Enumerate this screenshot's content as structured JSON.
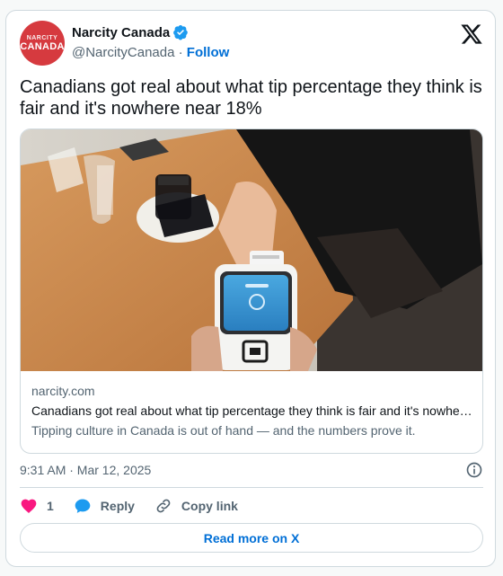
{
  "author": {
    "avatar_line1": "NARCITY",
    "avatar_line2": "CANADA",
    "display_name": "Narcity Canada",
    "handle": "@NarcityCanada",
    "separator": "·",
    "follow_label": "Follow",
    "verified": true
  },
  "tweet": {
    "text": "Canadians got real about what tip percentage they think is fair and it's nowhere near 18%"
  },
  "link_card": {
    "domain": "narcity.com",
    "title": "Canadians got real about what tip percentage they think is fair and it's nowhere near 18%",
    "description": "Tipping culture in Canada is out of hand — and the numbers prove it."
  },
  "meta": {
    "timestamp": "9:31 AM · Mar 12, 2025"
  },
  "actions": {
    "like_count": "1",
    "reply_label": "Reply",
    "copy_label": "Copy link"
  },
  "read_more_label": "Read more on X",
  "colors": {
    "accent": "#006fd6",
    "like": "#f91880",
    "avatar_bg": "#d63a3f",
    "verified": "#1d9bf0"
  }
}
